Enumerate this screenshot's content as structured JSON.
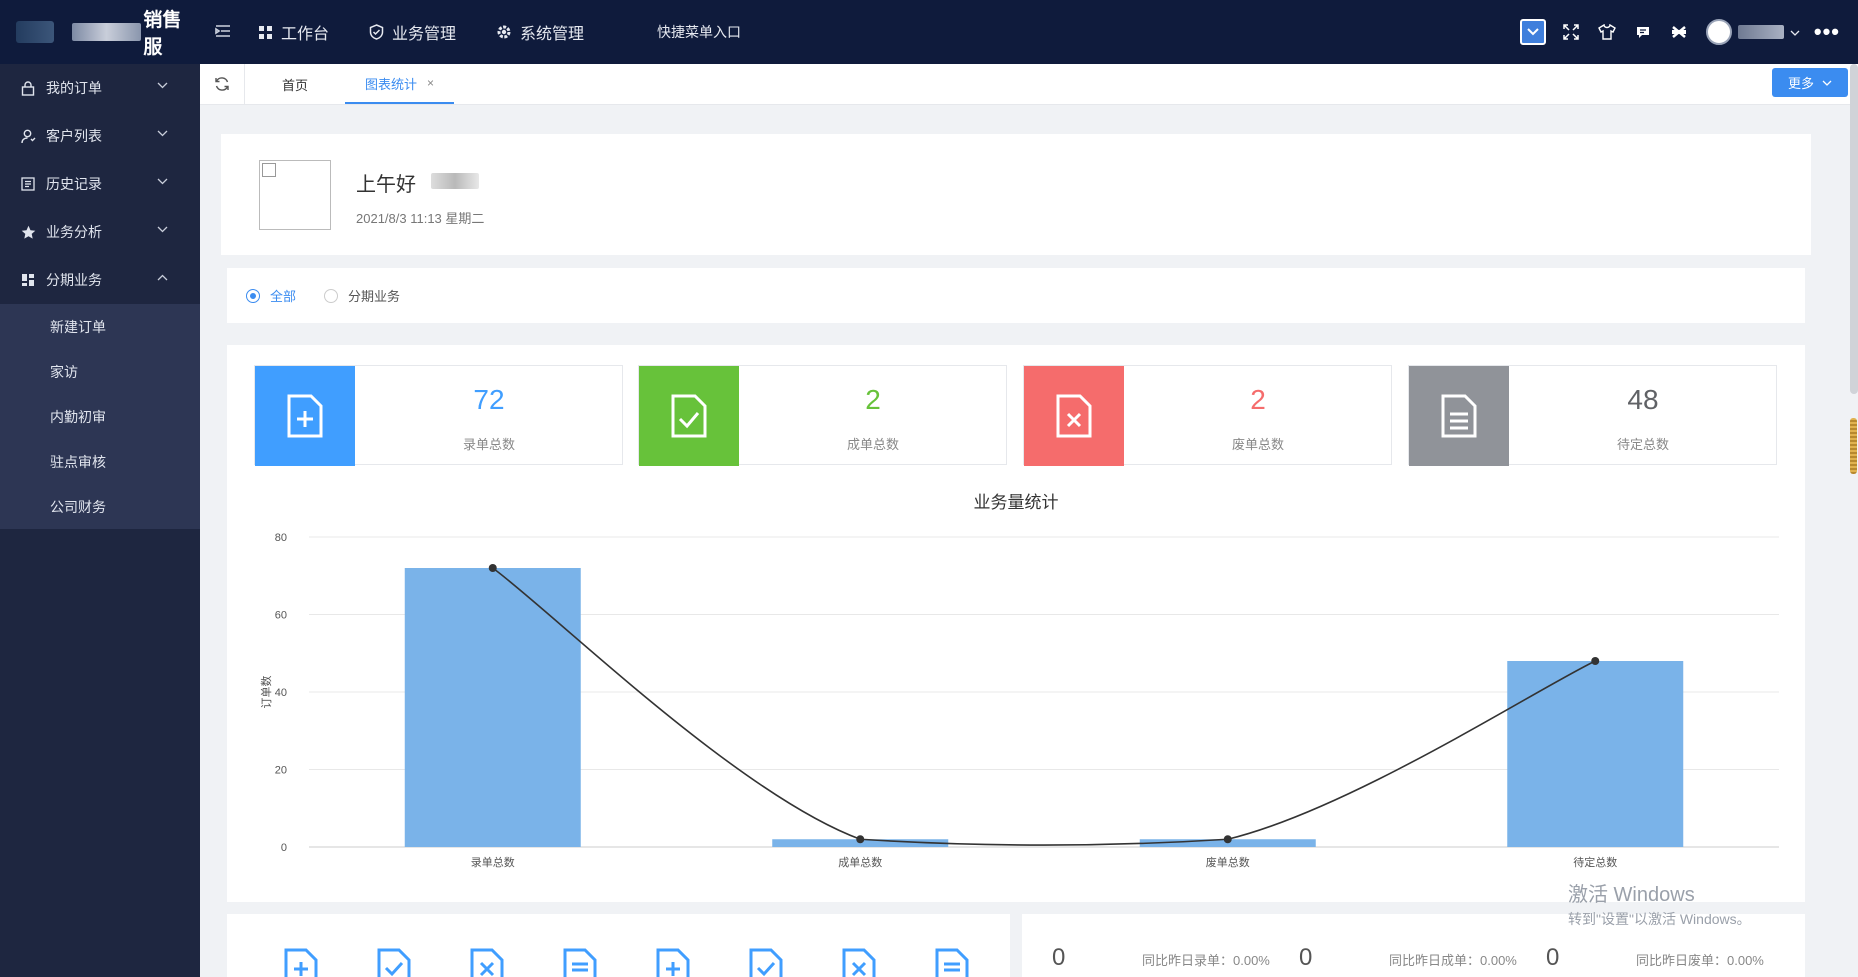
{
  "app": {
    "title": "销售服"
  },
  "topnav": {
    "items": [
      {
        "label": "工作台",
        "icon": "grid-icon"
      },
      {
        "label": "业务管理",
        "icon": "shield-icon"
      },
      {
        "label": "系统管理",
        "icon": "gear-icon"
      }
    ],
    "quick_entry": "快捷菜单入口"
  },
  "sidebar": {
    "items": [
      {
        "label": "我的订单",
        "icon": "lock-icon"
      },
      {
        "label": "客户列表",
        "icon": "user-icon"
      },
      {
        "label": "历史记录",
        "icon": "list-icon"
      },
      {
        "label": "业务分析",
        "icon": "star-icon"
      },
      {
        "label": "分期业务",
        "icon": "dashboard-icon"
      }
    ],
    "sub_items": [
      "新建订单",
      "家访",
      "内勤初审",
      "驻点审核",
      "公司财务"
    ]
  },
  "tabs": {
    "items": [
      "首页",
      "图表统计"
    ],
    "more": "更多"
  },
  "greeting": {
    "title": "上午好",
    "date": "2021/8/3 11:13 星期二"
  },
  "filter": {
    "options": [
      "全部",
      "分期业务"
    ],
    "selected": "全部"
  },
  "cards": [
    {
      "value": "72",
      "label": "录单总数",
      "color": "#409eff"
    },
    {
      "value": "2",
      "label": "成单总数",
      "color": "#67c23a"
    },
    {
      "value": "2",
      "label": "废单总数",
      "color": "#f56c6c"
    },
    {
      "value": "48",
      "label": "待定总数",
      "color": "#909399"
    }
  ],
  "chart_data": {
    "type": "bar",
    "title": "业务量统计",
    "ylabel": "订单数",
    "categories": [
      "录单总数",
      "成单总数",
      "废单总数",
      "待定总数"
    ],
    "series": [
      {
        "type": "bar",
        "values": [
          72,
          2,
          2,
          48
        ],
        "color": "#7ab3e9"
      },
      {
        "type": "line",
        "values": [
          72,
          2,
          2,
          48
        ],
        "color": "#333333"
      }
    ],
    "ylim": [
      0,
      80
    ],
    "yticks": [
      0,
      20,
      40,
      60,
      80
    ],
    "grid": true
  },
  "bottom_stats": [
    {
      "value": "0",
      "label": "同比昨日录单：0.00%"
    },
    {
      "value": "0",
      "label": "同比昨日成单：0.00%"
    },
    {
      "value": "0",
      "label": "同比昨日废单：0.00%"
    }
  ],
  "watermark": {
    "line1": "激活 Windows",
    "line2": "转到\"设置\"以激活 Windows。"
  }
}
